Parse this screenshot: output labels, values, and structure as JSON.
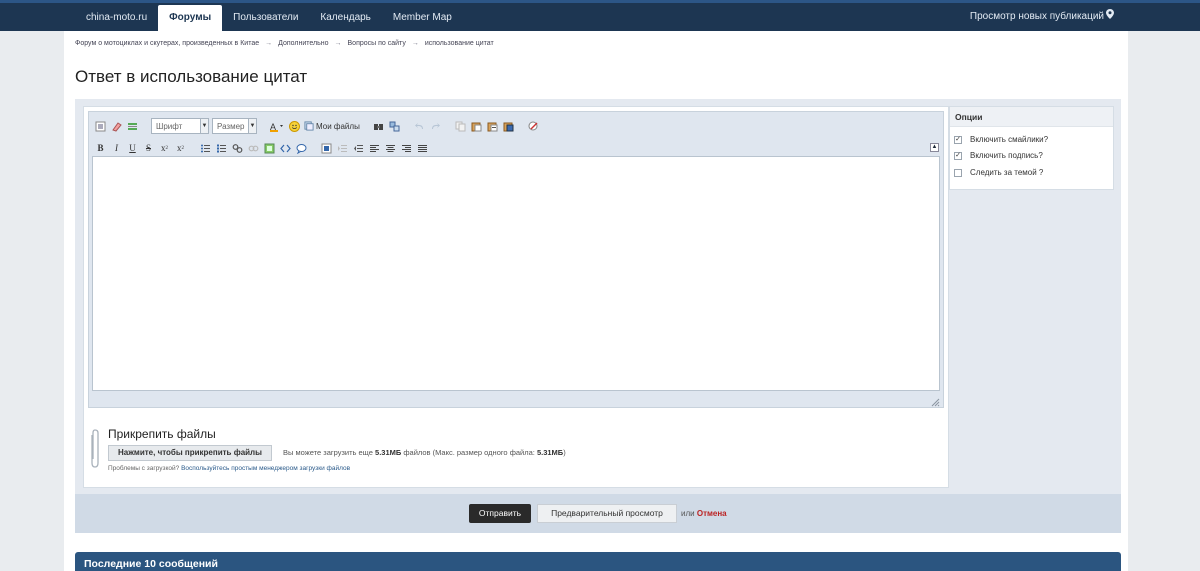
{
  "nav": {
    "items": [
      {
        "label": "china-moto.ru"
      },
      {
        "label": "Форумы"
      },
      {
        "label": "Пользователи"
      },
      {
        "label": "Календарь"
      },
      {
        "label": "Member Map"
      }
    ],
    "right_label": "Просмотр новых публикаций",
    "right_icon": "map-pin-icon"
  },
  "breadcrumb": [
    "Форум о мотоциклах и скутерах, произведенных в Китае",
    "Дополнительно",
    "Вопросы по сайту",
    "использование цитат"
  ],
  "breadcrumb_sep": "→",
  "page_title": "Ответ в использование цитат",
  "editor": {
    "font_select": "Шрифт",
    "size_select": "Размер",
    "my_files_label": "Мои файлы",
    "collapse_label": "▲"
  },
  "attach": {
    "title": "Прикрепить файлы",
    "button_label": "Нажмите, чтобы прикрепить файлы",
    "note_prefix": "Вы можете загрузить еще",
    "note_size": "5.31МБ",
    "note_mid": "файлов (Макс. размер одного файла:",
    "note_max": "5.31МБ",
    "note_suffix": ")",
    "help_prefix": "Проблемы с загрузкой?",
    "help_link": "Воспользуйтесь простым менеджером загрузки файлов"
  },
  "options": {
    "title": "Опции",
    "items": [
      {
        "label": "Включить смайлики?",
        "checked": true
      },
      {
        "label": "Включить подпись?",
        "checked": true
      },
      {
        "label": "Следить за темой ?",
        "checked": false
      }
    ]
  },
  "actions": {
    "submit": "Отправить",
    "preview": "Предварительный просмотр",
    "or": "или",
    "cancel": "Отмена"
  },
  "recent": {
    "title": "Последние 10 сообщений"
  },
  "colors": {
    "header_bg": "#1d3652",
    "accent": "#2b5580",
    "cancel": "#bb2222"
  }
}
